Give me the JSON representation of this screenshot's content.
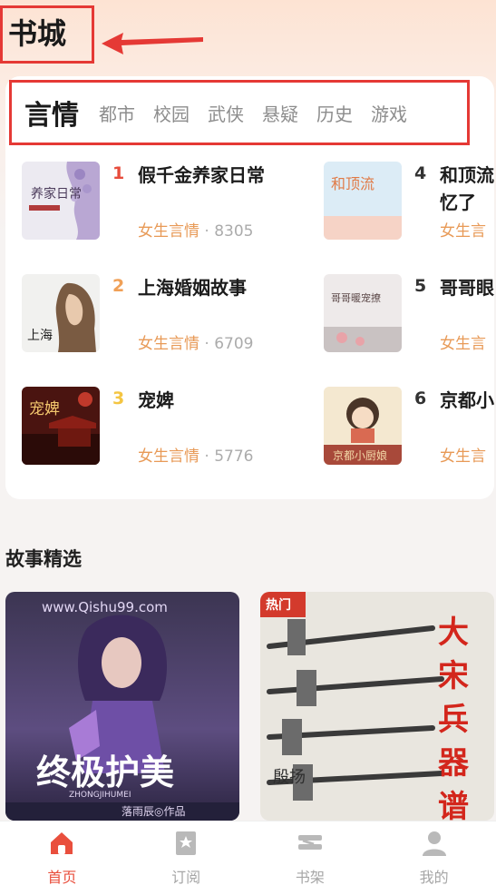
{
  "page": {
    "title": "书城"
  },
  "tabs": [
    {
      "label": "言情",
      "active": true
    },
    {
      "label": "都市"
    },
    {
      "label": "校园"
    },
    {
      "label": "武侠"
    },
    {
      "label": "悬疑"
    },
    {
      "label": "历史"
    },
    {
      "label": "游戏"
    }
  ],
  "rankings": [
    {
      "rank": "1",
      "title": "假千金养家日常",
      "category": "女生言情",
      "count": "8305",
      "rank_color": "#e74c3c",
      "cover_text": "养家日常"
    },
    {
      "rank": "2",
      "title": "上海婚姻故事",
      "category": "女生言情",
      "count": "6709",
      "rank_color": "#f0a057",
      "cover_text": "上海"
    },
    {
      "rank": "3",
      "title": "宠婢",
      "category": "女生言情",
      "count": "5776",
      "rank_color": "#f4c542",
      "cover_text": "宠婢"
    },
    {
      "rank": "4",
      "title": "和顶流",
      "title_line2": "忆了",
      "category": "女生言",
      "rank_color": "#333333",
      "cover_text": "和顶流"
    },
    {
      "rank": "5",
      "title": "哥哥眼",
      "category": "女生言",
      "rank_color": "#333333",
      "cover_text": "哥哥暖宠撩"
    },
    {
      "rank": "6",
      "title": "京都小",
      "category": "女生言",
      "rank_color": "#333333",
      "cover_text": "京都小厨娘"
    }
  ],
  "section": {
    "title": "故事精选"
  },
  "stories": [
    {
      "title": "终极护美",
      "subtitle": "ZHONGJIHUMEI",
      "watermark": "www.Qishu99.com",
      "author": "落雨辰◎作品"
    },
    {
      "title": "大宋兵器谱",
      "author": "殷扬",
      "corner": "热门"
    }
  ],
  "nav": [
    {
      "label": "首页",
      "icon": "home-icon",
      "active": true
    },
    {
      "label": "订阅",
      "icon": "bookmark-icon"
    },
    {
      "label": "书架",
      "icon": "bookshelf-icon"
    },
    {
      "label": "我的",
      "icon": "profile-icon"
    }
  ],
  "colors": {
    "accent": "#e94f3d",
    "category_text": "#e89a57",
    "annotation": "#e53935"
  }
}
